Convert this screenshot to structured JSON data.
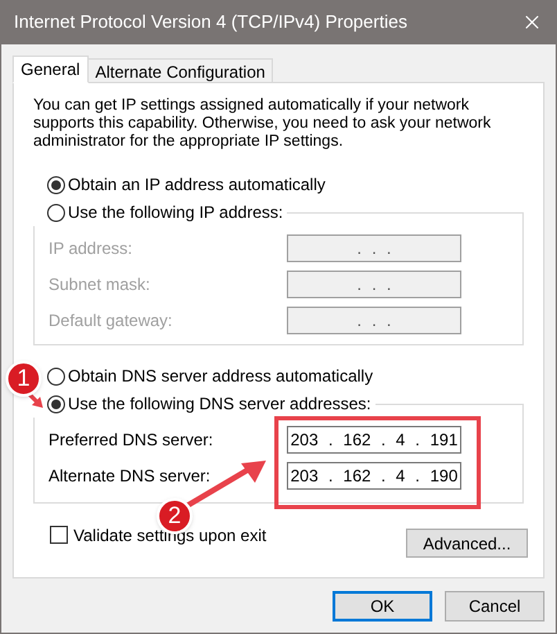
{
  "window": {
    "title": "Internet Protocol Version 4 (TCP/IPv4) Properties"
  },
  "tabs": [
    {
      "label": "General",
      "selected": true
    },
    {
      "label": "Alternate Configuration",
      "selected": false
    }
  ],
  "description": "You can get IP settings assigned automatically if your network supports this capability. Otherwise, you need to ask your network administrator for the appropriate IP settings.",
  "ip_mode": [
    {
      "label": "Obtain an IP address automatically",
      "selected": true
    },
    {
      "label": "Use the following IP address:",
      "selected": false
    }
  ],
  "ip_fields": [
    {
      "label": "IP address:",
      "value": ". . .",
      "disabled": true
    },
    {
      "label": "Subnet mask:",
      "value": ". . .",
      "disabled": true
    },
    {
      "label": "Default gateway:",
      "value": ". . .",
      "disabled": true
    }
  ],
  "dns_mode": [
    {
      "label": "Obtain DNS server address automatically",
      "selected": false
    },
    {
      "label": "Use the following DNS server addresses:",
      "selected": true
    }
  ],
  "dns_fields": [
    {
      "label": "Preferred DNS server:",
      "value": "203 . 162 . 4 . 191",
      "disabled": false
    },
    {
      "label": "Alternate DNS server:",
      "value": "203 . 162 . 4 . 190",
      "disabled": false
    }
  ],
  "validate": {
    "label": "Validate settings upon exit",
    "checked": false
  },
  "advanced_button": "Advanced...",
  "buttons": [
    {
      "label": "OK",
      "default": true
    },
    {
      "label": "Cancel",
      "default": false
    }
  ],
  "step_markers": [
    {
      "label": "1"
    },
    {
      "label": "2"
    }
  ]
}
